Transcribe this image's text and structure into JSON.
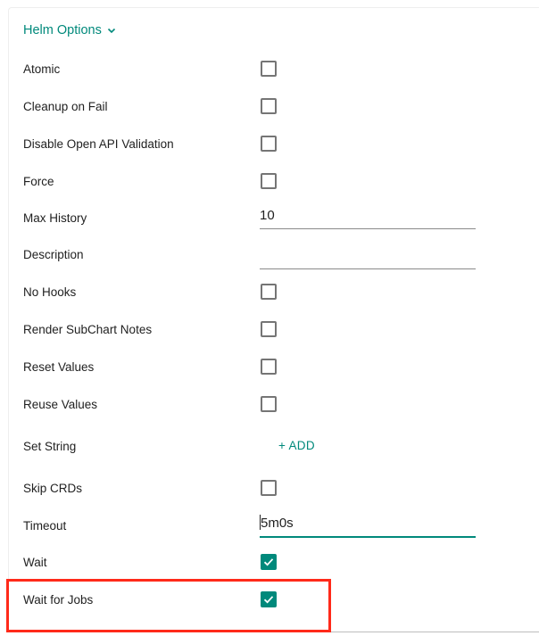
{
  "section": {
    "title": "Helm Options",
    "expanded": true
  },
  "options": {
    "atomic": {
      "label": "Atomic",
      "checked": false
    },
    "cleanup_on_fail": {
      "label": "Cleanup on Fail",
      "checked": false
    },
    "disable_openapi_validation": {
      "label": "Disable Open API Validation",
      "checked": false
    },
    "force": {
      "label": "Force",
      "checked": false
    },
    "max_history": {
      "label": "Max History",
      "value": "10"
    },
    "description": {
      "label": "Description",
      "value": ""
    },
    "no_hooks": {
      "label": "No Hooks",
      "checked": false
    },
    "render_subchart_notes": {
      "label": "Render SubChart Notes",
      "checked": false
    },
    "reset_values": {
      "label": "Reset Values",
      "checked": false
    },
    "reuse_values": {
      "label": "Reuse Values",
      "checked": false
    },
    "set_string": {
      "label": "Set String",
      "add_label": "+ ADD"
    },
    "skip_crds": {
      "label": "Skip CRDs",
      "checked": false
    },
    "timeout": {
      "label": "Timeout",
      "value": "5m0s"
    },
    "wait": {
      "label": "Wait",
      "checked": true
    },
    "wait_for_jobs": {
      "label": "Wait for Jobs",
      "checked": true
    }
  },
  "colors": {
    "accent": "#00897b",
    "highlight": "#ff2a1a"
  }
}
